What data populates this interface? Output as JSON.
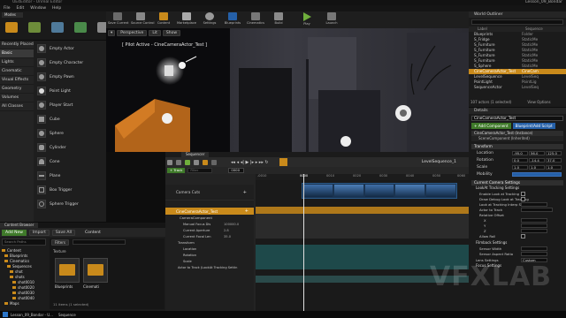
{
  "window": {
    "title": "UE4Editor - Unreal Editor",
    "right_title": "Lesson_09_Bondar"
  },
  "menu": [
    "File",
    "Edit",
    "Window",
    "Help"
  ],
  "modes": {
    "tab": "Modes",
    "search_placeholder": "Search Classes"
  },
  "categories": [
    "Recently Placed",
    "Basic",
    "Lights",
    "Cinematic",
    "Visual Effects",
    "Geometry",
    "Volumes",
    "All Classes"
  ],
  "place_items": [
    "Empty Actor",
    "Empty Character",
    "Empty Pawn",
    "Point Light",
    "Player Start",
    "Cube",
    "Sphere",
    "Cylinder",
    "Cone",
    "Plane",
    "Box Trigger",
    "Sphere Trigger"
  ],
  "toolbar": [
    {
      "label": "Save Current",
      "icon": "save-icon"
    },
    {
      "label": "Source Control",
      "icon": "source-control-icon"
    },
    {
      "label": "Content",
      "icon": "content-icon"
    },
    {
      "label": "Marketplace",
      "icon": "marketplace-icon"
    },
    {
      "label": "Settings",
      "icon": "settings-icon"
    },
    {
      "label": "Blueprints",
      "icon": "blueprints-icon"
    },
    {
      "label": "Cinematics",
      "icon": "cinematics-icon"
    },
    {
      "label": "Build",
      "icon": "build-icon"
    },
    {
      "label": "Play",
      "icon": "play-icon"
    },
    {
      "label": "Launch",
      "icon": "launch-icon"
    }
  ],
  "viewport": {
    "mode": "Perspective",
    "lit": "Lit",
    "show": "Show",
    "pilot": "[ Pilot Active - CineCameraActor_Test ]"
  },
  "outliner": {
    "title": "World Outliner",
    "col_label": "Label",
    "col_type": "Sequence",
    "rows": [
      {
        "label": "Blueprints",
        "type": "Folder"
      },
      {
        "label": "S_Fridge",
        "type": "StaticMe"
      },
      {
        "label": "S_Furniture",
        "type": "StaticMe"
      },
      {
        "label": "S_Furniture",
        "type": "StaticMe"
      },
      {
        "label": "S_Furniture",
        "type": "StaticMe"
      },
      {
        "label": "S_Furniture",
        "type": "StaticMe"
      },
      {
        "label": "S_Sphere",
        "type": "StaticMe"
      },
      {
        "label": "CineCameraActor_Test",
        "type": "CineCam",
        "selected": true
      },
      {
        "label": "LevelSequence",
        "type": "LevelSeq"
      },
      {
        "label": "PointLight",
        "type": "PointLig"
      },
      {
        "label": "SequenceActor",
        "type": "LevelSeq"
      }
    ],
    "count": "107 actors (1 selected)",
    "view_options": "View Options"
  },
  "details": {
    "title": "Details",
    "name": "CineCameraActor_Test",
    "add_component": "+ Add Component",
    "blueprint": "Blueprint/Add Script",
    "instance": "CineCameraActor_Test (Instance)",
    "scene_component": "SceneComponent (Inherited)",
    "transform": "Transform",
    "location": "Location",
    "rotation": "Rotation",
    "scale": "Scale",
    "loc": [
      "-95.0",
      "56.0",
      "125.0"
    ],
    "rot": [
      "0.0",
      "-14.4",
      "37.0"
    ],
    "scl": [
      "1.0",
      "1.0",
      "1.0"
    ],
    "mobility": "Mobility",
    "camera_settings": "Current Camera Settings",
    "lookat": "LookAt Tracking Settings",
    "lookat_rows": [
      "Enable Look at Tracking",
      "Draw Debug Look at Tracking",
      "Look at Tracking Interp Speed",
      "Actor to Track",
      "Relative Offset",
      "X",
      "Y",
      "Z",
      "Allow Roll"
    ],
    "filmback": "Filmback Settings",
    "sensor": "Sensor Width",
    "aspect": "Sensor Aspect Ratio",
    "lens": "Lens Settings",
    "lens_value": "Custom",
    "focus": "Focus Settings"
  },
  "sequencer": {
    "tab": "Sequencer",
    "level_sequence": "LevelSequence_1",
    "track": "+ Track",
    "filter": "Filter",
    "frame": "0000",
    "time_marks": [
      "-0010",
      "0000",
      "0010",
      "0020",
      "0030",
      "0040",
      "0050",
      "0060",
      "0070"
    ],
    "tracks": [
      {
        "name": "Camera Cuts",
        "type": "cuts"
      },
      {
        "name": "CineCameraActor_Test",
        "type": "actor"
      },
      {
        "name": "CameraComponent",
        "type": "component"
      },
      {
        "name": "Manual Focus Dis",
        "type": "prop",
        "value": "100000.0"
      },
      {
        "name": "Current Aperture",
        "type": "prop",
        "value": "2.8"
      },
      {
        "name": "Current Focal Len",
        "type": "prop",
        "value": "35.0"
      },
      {
        "name": "Transform",
        "type": "transform"
      },
      {
        "name": "Location",
        "type": "sub"
      },
      {
        "name": "Rotation",
        "type": "sub"
      },
      {
        "name": "Scale",
        "type": "sub"
      },
      {
        "name": "Actor to Track (LookAt Tracking Settin",
        "type": "sub"
      }
    ]
  },
  "content_browser": {
    "tab": "Content Browser",
    "add_new": "Add New",
    "import": "Import",
    "save_all": "Save All",
    "path": "Content",
    "filters": "Filters",
    "search_placeholder": "Search Paths",
    "tree": [
      "Content",
      "Blueprints",
      "Cinematics",
      "Sequences",
      "shot",
      "shots",
      "shot0010",
      "shot0020",
      "shot0030",
      "shot0040",
      "Maps"
    ],
    "assets": [
      "Blueprints",
      "Cinemati"
    ],
    "status": "11 items (1 selected)",
    "texture": "Texture"
  },
  "taskbar": [
    "Lesson_09_Bondar - U...",
    "Sequence"
  ],
  "watermark": "VFXLAB",
  "colors": {
    "accent": "#c98a1b",
    "selection": "#c98a1b",
    "blue": "#2560a8",
    "green": "#3f7a2a"
  }
}
